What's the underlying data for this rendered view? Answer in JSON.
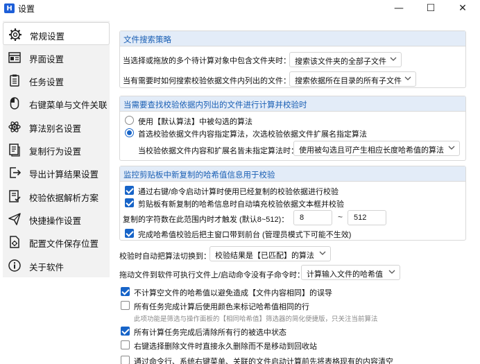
{
  "window": {
    "title": "设置",
    "app_icon_letter": "H",
    "min_symbol": "—",
    "max_symbol": "☐",
    "close_symbol": "✕"
  },
  "sidebar": {
    "items": [
      {
        "label": "常规设置",
        "icon": "gear-icon",
        "selected": true
      },
      {
        "label": "界面设置",
        "icon": "window-icon",
        "selected": false
      },
      {
        "label": "任务设置",
        "icon": "clipboard-icon",
        "selected": false
      },
      {
        "label": "右键菜单与文件关联",
        "icon": "mouse-icon",
        "selected": false
      },
      {
        "label": "算法别名设置",
        "icon": "atom-icon",
        "selected": false
      },
      {
        "label": "复制行为设置",
        "icon": "copy-document-icon",
        "selected": false
      },
      {
        "label": "导出计算结果设置",
        "icon": "export-icon",
        "selected": false
      },
      {
        "label": "校验依据解析方案",
        "icon": "checklist-icon",
        "selected": false
      },
      {
        "label": "快捷操作设置",
        "icon": "paper-plane-icon",
        "selected": false
      },
      {
        "label": "配置文件保存位置",
        "icon": "settings-file-icon",
        "selected": false
      },
      {
        "label": "关于软件",
        "icon": "info-icon",
        "selected": false
      }
    ]
  },
  "file_search": {
    "header": "文件搜索策略",
    "row1_label": "当选择或拖放的多个待计算对象中包含文件夹时：",
    "row1_value": "搜索该文件夹的全部子文件",
    "row2_label": "当有需要时如何搜索校验依据文件内列出的文件：",
    "row2_value": "搜索依据所在目录的所有子文件"
  },
  "algo_check": {
    "header": "当需要查找校验依据内列出的文件进行计算并校验时",
    "radio1": "使用【默认算法】中被勾选的算法",
    "radio2": "首选校验依据文件内容指定算法，次选校验依据文件扩展名指定算法",
    "sub_label": "当校验依据文件内容和扩展名皆未指定算法时：",
    "sub_value": "使用被勾选且可产生相应长度哈希值的算法"
  },
  "clipboard": {
    "header": "监控剪贴板中新复制的哈希值信息用于校验",
    "cb1": "通过右键/命令启动计算时使用已经复制的校验依据进行校验",
    "cb2": "剪贴板有新复制的哈希信息时自动填充校验依据文本框并校验",
    "range_label": "复制的字符数在此范围内时才触发 (默认8~512)：",
    "range_min": "8",
    "range_sep": "~",
    "range_max": "512",
    "cb3": "完成哈希值校验后把主窗口带到前台 (管理员模式下可能不生效)"
  },
  "general": {
    "auto_switch_label": "校验时自动把算法切换到：",
    "auto_switch_value": "校验结果是【已匹配】的算法",
    "drag_label": "拖动文件到软件可执行文件上/启动命令没有子命令时：",
    "drag_value": "计算输入文件的哈希值",
    "opt1": "不计算空文件的哈希值以避免造成【文件内容相同】的误导",
    "opt2": "所有任务完成计算后使用颜色来标记哈希值相同的行",
    "opt2_hint": "此项功能是筛选与操作面板的【相同哈希值】筛选器的简化便捷版，只关注当前算法",
    "opt3": "所有计算任务完成后清除所有行的被选中状态",
    "opt4": "右键选择删除文件时直接永久删除而不是移动到回收站",
    "opt5": "通过命令行、系统右键菜单、关联的文件启动计算前先将表格现有的内容清空"
  },
  "colors": {
    "accent": "#1764c8",
    "group_header_bg": "#e3ecf8",
    "group_header_text": "#1a5fb4",
    "sidebar_bg": "#f2f2f2"
  }
}
